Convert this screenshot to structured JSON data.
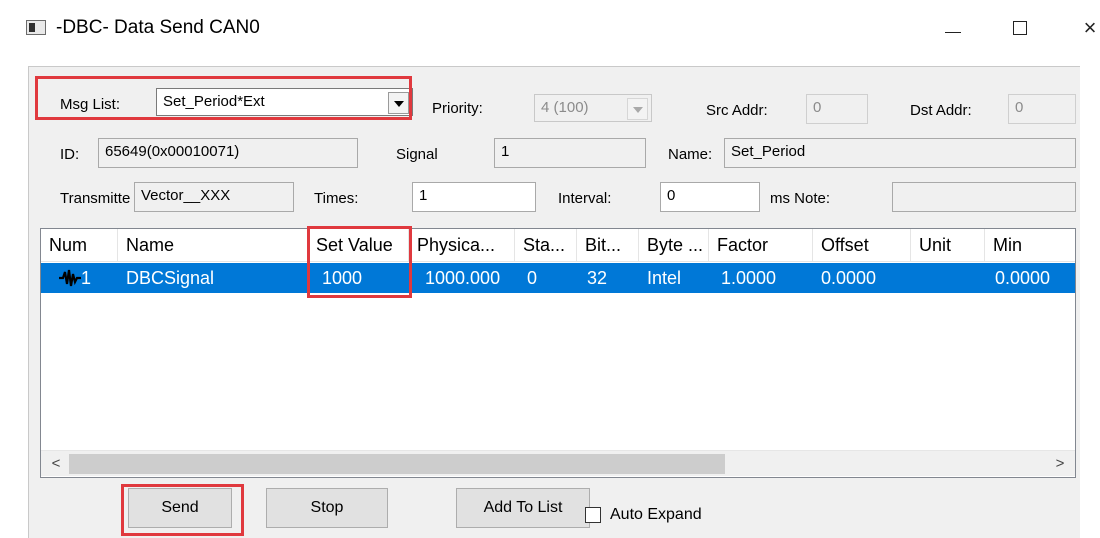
{
  "window": {
    "title": "-DBC- Data Send CAN0",
    "min_glyph": "",
    "max_glyph": "",
    "close_glyph": "×"
  },
  "form": {
    "msg_list_label": "Msg List:",
    "msg_list_value": "Set_Period*Ext",
    "priority_label": "Priority:",
    "priority_value": "4 (100)",
    "src_addr_label": "Src Addr:",
    "src_addr_value": "0",
    "dst_addr_label": "Dst Addr:",
    "dst_addr_value": "0",
    "id_label": "ID:",
    "id_value": "65649(0x00010071)",
    "signal_label": "Signal",
    "signal_value": "1",
    "name_label": "Name:",
    "name_value": "Set_Period",
    "transmitter_label": "Transmitte",
    "transmitter_value": "Vector__XXX",
    "times_label": "Times:",
    "times_value": "1",
    "interval_label": "Interval:",
    "interval_value": "0",
    "ms_note_label": "ms Note:",
    "note_value": ""
  },
  "table": {
    "columns": [
      "Num",
      "Name",
      "Set Value",
      "Physica...",
      "Sta...",
      "Bit...",
      "Byte ...",
      "Factor",
      "Offset",
      "Unit",
      "Min"
    ],
    "rows": [
      {
        "num": "1",
        "name": "DBCSignal",
        "set_value": "1000",
        "physical": "1000.000",
        "start": "0",
        "bits": "32",
        "byte_order": "Intel",
        "factor": "1.0000",
        "offset": "0.0000",
        "unit": "",
        "min": "0.0000"
      }
    ],
    "row_icon": "signal-wave-icon",
    "scroll_left": "<",
    "scroll_right": ">"
  },
  "buttons": {
    "send": "Send",
    "stop": "Stop",
    "add_to_list": "Add To List",
    "auto_expand": "Auto Expand"
  },
  "colors": {
    "selection": "#0078d7",
    "highlight_box": "#e0393e"
  }
}
